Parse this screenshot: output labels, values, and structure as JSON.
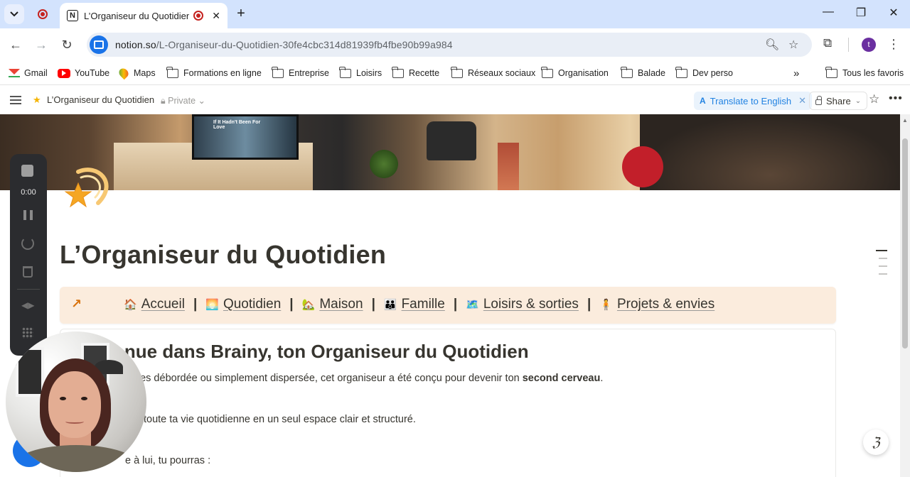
{
  "browser": {
    "tab_title": "L’Organiseur du Quotidien",
    "url_host": "notion.so",
    "url_path": "/L-Organiseur-du-Quotidien-30fe4cbc314d81939fb4fbe90b99a984",
    "profile_initial": "t"
  },
  "bookmarks": {
    "items": [
      "Gmail",
      "YouTube",
      "Maps",
      "Formations en ligne",
      "Entreprise",
      "Loisirs",
      "Recette",
      "Réseaux sociaux",
      "Organisation",
      "Balade",
      "Dev perso"
    ],
    "overflow": "»",
    "all_favorites": "Tous les favoris"
  },
  "notion_bar": {
    "page_title": "L’Organiseur du Quotidien",
    "privacy": "Private",
    "translate_label": "Translate to English",
    "share_label": "Share"
  },
  "page": {
    "title": "L’Organiseur du Quotidien",
    "nav": [
      {
        "emoji": "🏠",
        "label": "Accueil"
      },
      {
        "emoji": "🌅",
        "label": "Quotidien"
      },
      {
        "emoji": "🏡",
        "label": "Maison"
      },
      {
        "emoji": "👪",
        "label": "Famille"
      },
      {
        "emoji": "🗺️",
        "label": "Loisirs & sorties"
      },
      {
        "emoji": "🧍",
        "label": "Projets & envies"
      }
    ],
    "separator": "|",
    "heading": "venue dans Brainy, ton Organiseur du Quotidien",
    "para1_pre": "ntes débordée ou simplement dispersée, cet organiseur a été conçu pour devenir ton ",
    "para1_bold": "second cerveau",
    "para1_post": ".",
    "para2": "toute ta vie quotidienne en un seul espace clair et structuré.",
    "para3": "e à lui, tu pourras :"
  },
  "cover": {
    "tv_text": "If It Hadn't Been For Love"
  },
  "recorder": {
    "time": "0:00"
  }
}
